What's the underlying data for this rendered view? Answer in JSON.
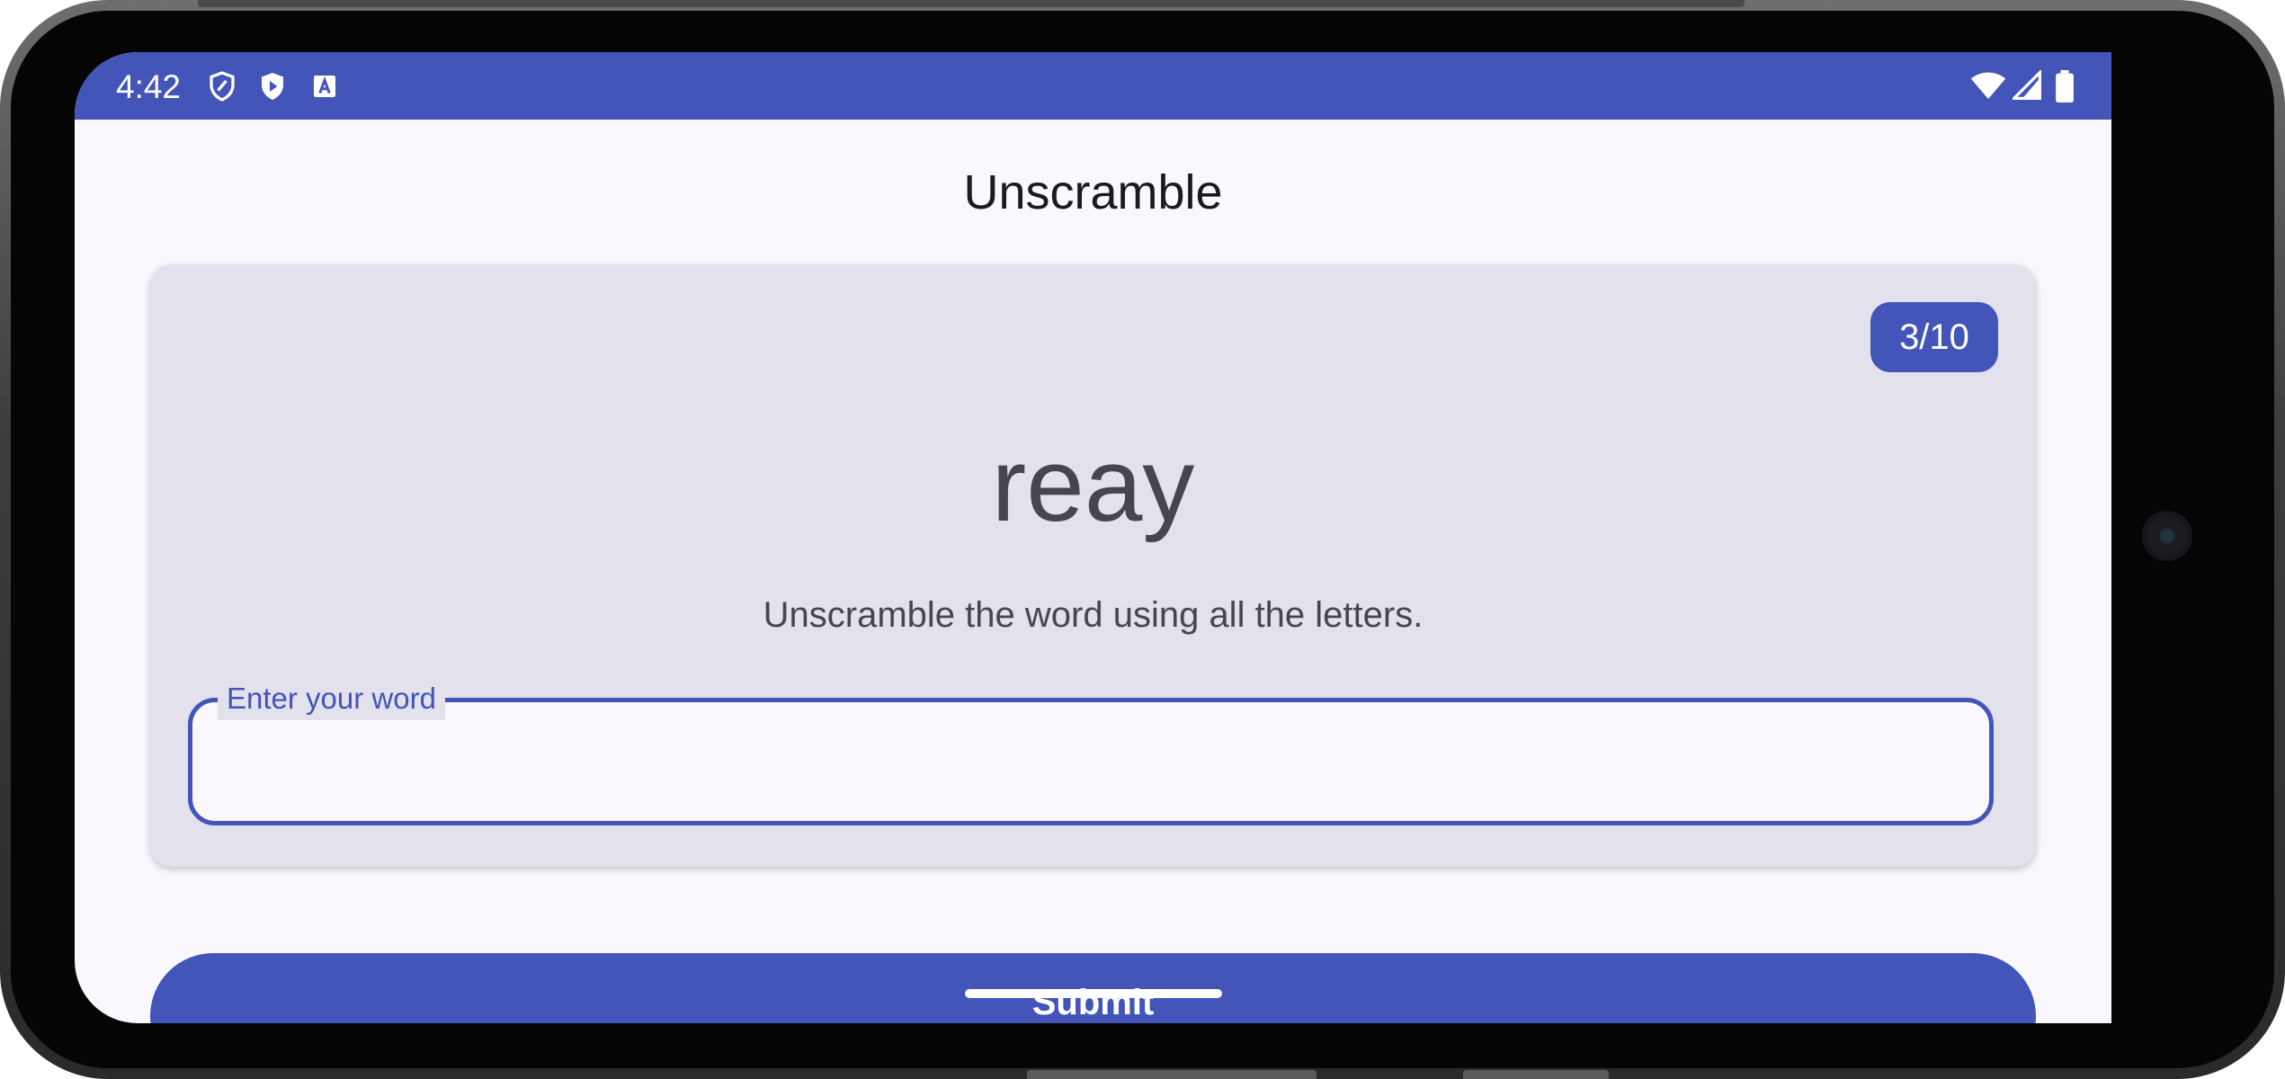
{
  "status_bar": {
    "time": "4:42",
    "background_color": "#4355b9",
    "left_icons": [
      "shield-icon",
      "play-shield-icon",
      "font-icon"
    ],
    "right_icons": [
      "wifi-icon",
      "signal-icon",
      "battery-icon"
    ]
  },
  "app": {
    "title": "Unscramble"
  },
  "card": {
    "word_count": "3/10",
    "scrambled_word": "reay",
    "instructions": "Unscramble the word using all the letters.",
    "input": {
      "label": "Enter your word",
      "value": ""
    }
  },
  "actions": {
    "submit_label": "Submit"
  },
  "colors": {
    "primary": "#4355b9",
    "surface": "#fbf8fd",
    "card_surface": "#e2e1ec",
    "on_surface_variant": "#45464f"
  }
}
